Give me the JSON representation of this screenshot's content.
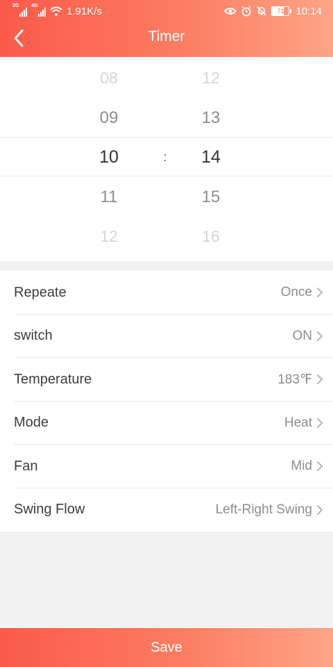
{
  "status_bar": {
    "net1": "2G",
    "net2": "4G",
    "speed": "1.91K/s",
    "battery": "71",
    "time": "10:14"
  },
  "header": {
    "title": "Timer"
  },
  "picker": {
    "hours": [
      "08",
      "09",
      "10",
      "11",
      "12"
    ],
    "minutes": [
      "12",
      "13",
      "14",
      "15",
      "16"
    ],
    "separator": ":"
  },
  "settings": [
    {
      "label": "Repeate",
      "value": "Once"
    },
    {
      "label": "switch",
      "value": "ON"
    },
    {
      "label": "Temperature",
      "value": "183℉"
    },
    {
      "label": "Mode",
      "value": "Heat"
    },
    {
      "label": "Fan",
      "value": "Mid"
    },
    {
      "label": "Swing Flow",
      "value": "Left-Right Swing"
    }
  ],
  "footer": {
    "save_label": "Save"
  },
  "colors": {
    "accent_start": "#fb5a4a",
    "accent_end": "#fda487"
  }
}
